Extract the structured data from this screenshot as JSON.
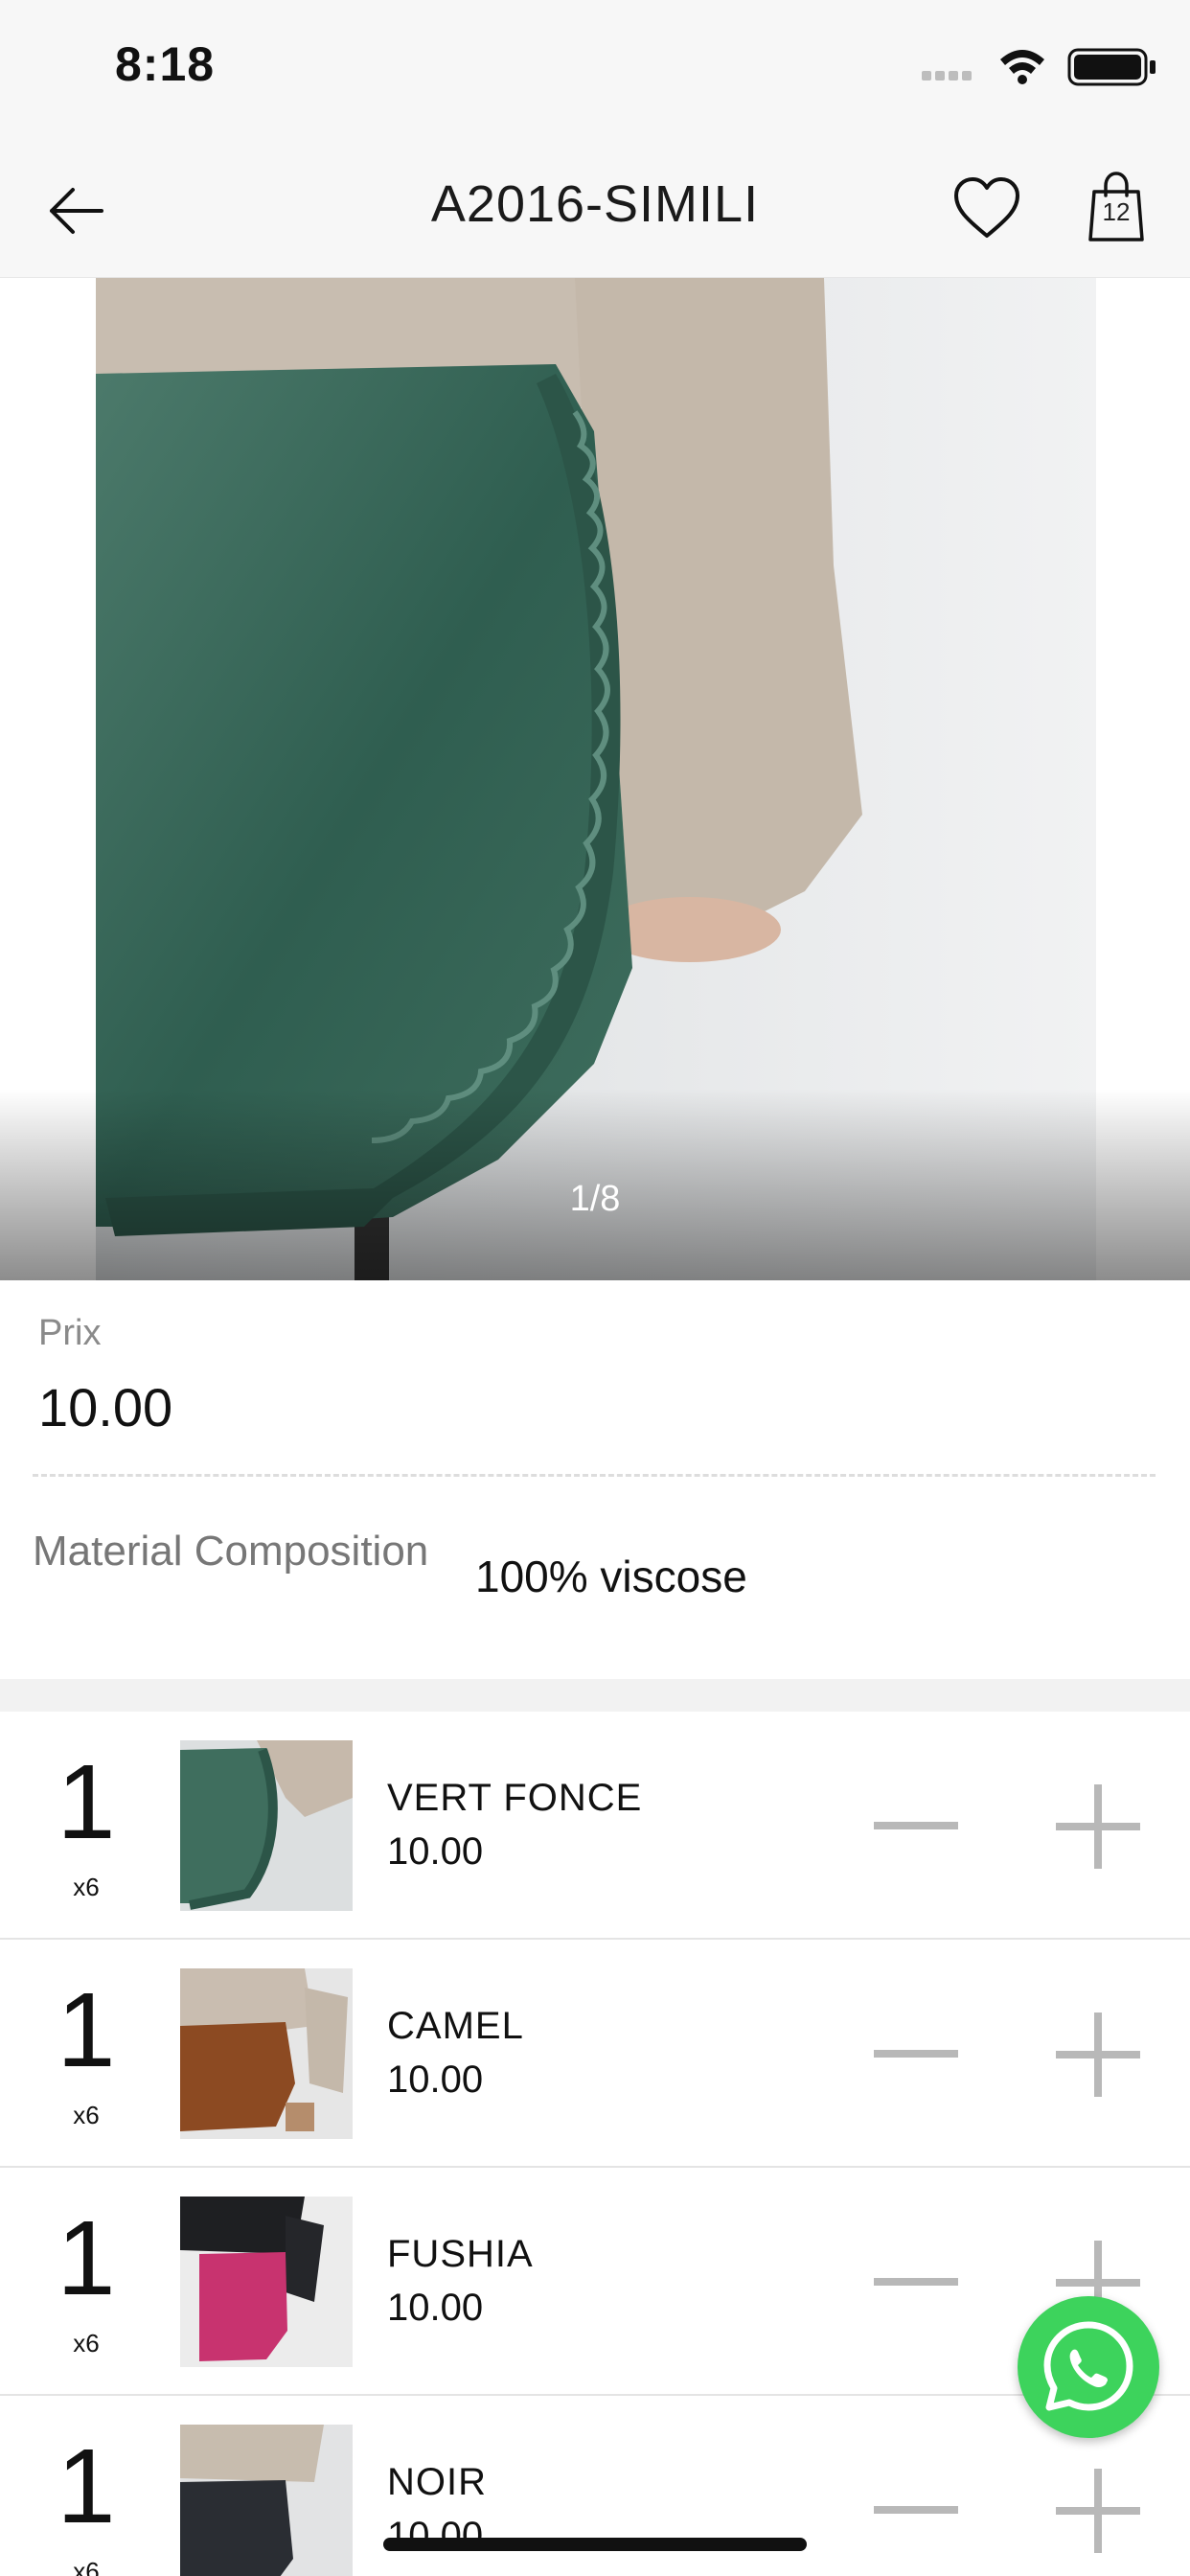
{
  "status_bar": {
    "time": "8:18",
    "icons": [
      "cellular-signal-icon",
      "wifi-icon",
      "battery-icon"
    ]
  },
  "nav": {
    "title": "A2016-SIMILI",
    "back_icon": "arrow-left-icon",
    "favorite_icon": "heart-icon",
    "bag_icon": "shopping-bag-icon",
    "bag_count": "12"
  },
  "gallery": {
    "counter": "1/8",
    "skirt_color": "#3f6e5e"
  },
  "price": {
    "label": "Prix",
    "value": "10.00"
  },
  "material": {
    "label": "Material Composition",
    "value": "100% viscose"
  },
  "variants": [
    {
      "qty": "1",
      "multiplier": "x6",
      "name": "VERT FONCE",
      "price": "10.00",
      "swatch": "#3f6e5e"
    },
    {
      "qty": "1",
      "multiplier": "x6",
      "name": "CAMEL",
      "price": "10.00",
      "swatch": "#8c4a22"
    },
    {
      "qty": "1",
      "multiplier": "x6",
      "name": "FUSHIA",
      "price": "10.00",
      "swatch": "#c8336f"
    },
    {
      "qty": "1",
      "multiplier": "x6",
      "name": "NOIR",
      "price": "10.00",
      "swatch": "#2a2d33"
    }
  ],
  "colors": {
    "whatsapp": "#3dd35c",
    "stepper": "#b8b8b8"
  }
}
